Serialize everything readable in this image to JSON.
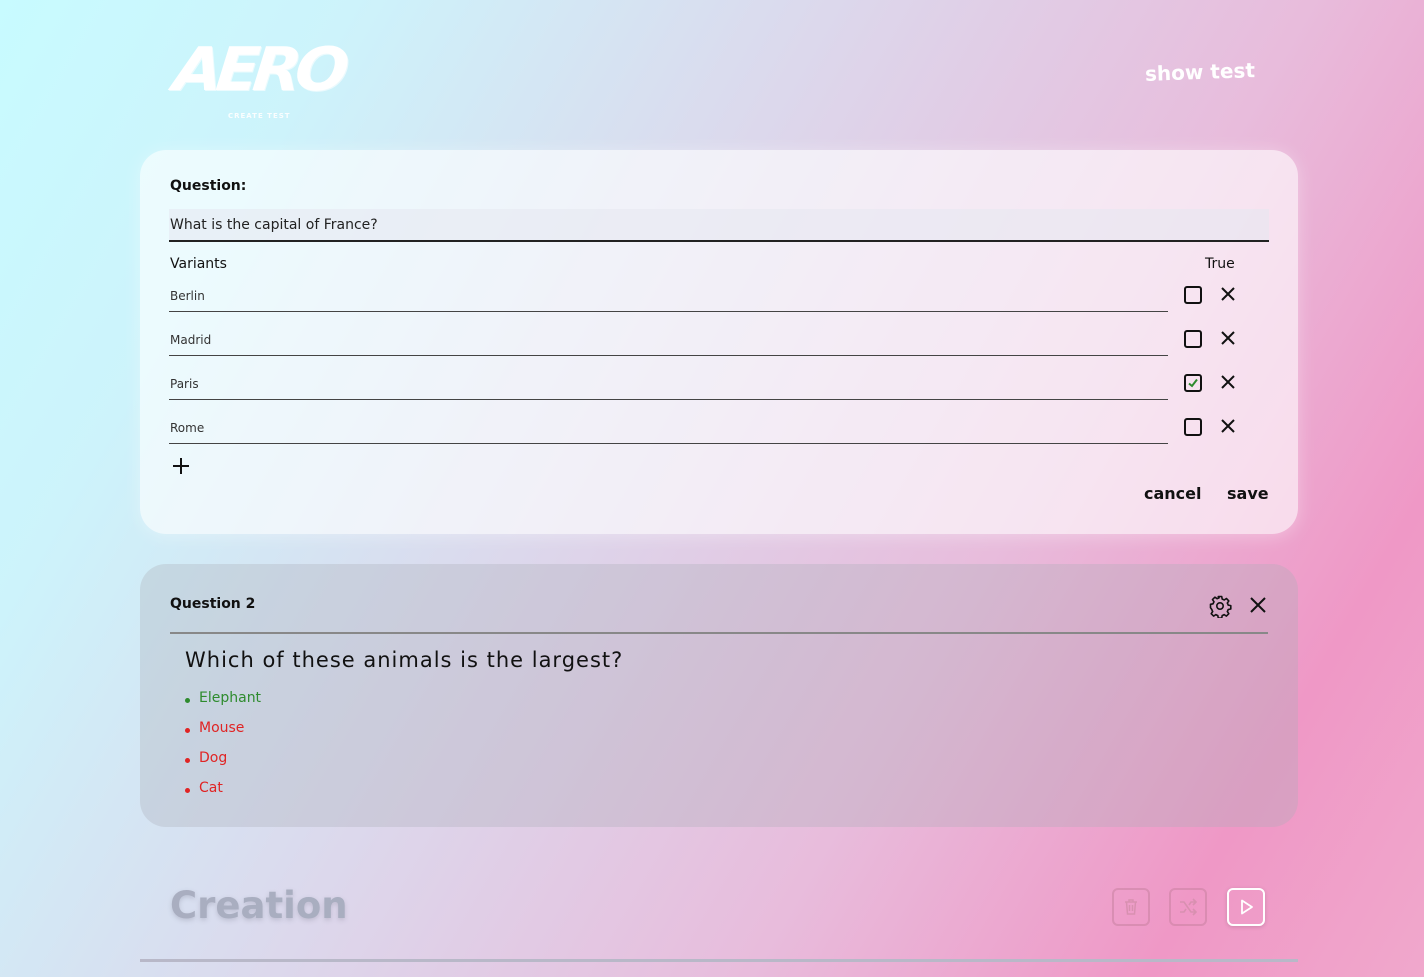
{
  "header": {
    "logo_text": "AERO",
    "logo_subtitle": "CREATE TEST",
    "show_test_label": "show test"
  },
  "editor": {
    "question_label": "Question:",
    "question_value": "What is the capital of France?",
    "variants_label": "Variants",
    "true_label": "True",
    "variants": [
      {
        "text": "Berlin",
        "correct": false
      },
      {
        "text": "Madrid",
        "correct": false
      },
      {
        "text": "Paris",
        "correct": true
      },
      {
        "text": "Rome",
        "correct": false
      }
    ],
    "cancel_label": "cancel",
    "save_label": "save"
  },
  "question2": {
    "title": "Question 2",
    "text": "Which of these animals is the largest?",
    "answers": [
      {
        "text": "Elephant",
        "correct": true
      },
      {
        "text": "Mouse",
        "correct": false
      },
      {
        "text": "Dog",
        "correct": false
      },
      {
        "text": "Cat",
        "correct": false
      }
    ]
  },
  "footer": {
    "title": "Creation"
  },
  "colors": {
    "correct": "#2e8b2e",
    "incorrect": "#e02424",
    "check": "#2e8b2e"
  }
}
